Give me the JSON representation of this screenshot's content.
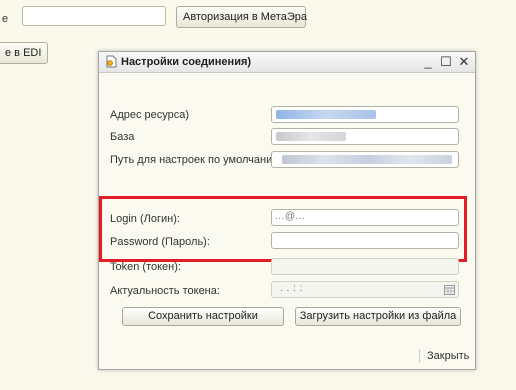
{
  "background": {
    "label_cut": "е",
    "auth_button_label": "Авторизация в МетаЭра",
    "edi_button_label": "е в EDI"
  },
  "dialog": {
    "title": "Настройки соединения)",
    "window_controls": {
      "minimize": "_",
      "maximize": "☐",
      "close": "✕"
    },
    "fields": [
      {
        "label": "Адрес ресурса)",
        "value": ""
      },
      {
        "label": "База",
        "value": ""
      },
      {
        "label": "Путь для настроек по умолчанию:",
        "value": ""
      },
      {
        "label": "Login (Логин):",
        "value": "...@..."
      },
      {
        "label": "Password (Пароль):",
        "value": ""
      },
      {
        "label": "Token (токен):",
        "value": ""
      },
      {
        "label": "Актуальность токена:",
        "value": ". .   : :"
      }
    ],
    "buttons": {
      "save": "Сохранить настройки",
      "load": "Загрузить настройки из файла"
    },
    "close_label": "Закрыть"
  },
  "colors": {
    "highlight": "#e31d25",
    "background": "#fbf9ec",
    "dialog_background": "#fbfaf0"
  }
}
